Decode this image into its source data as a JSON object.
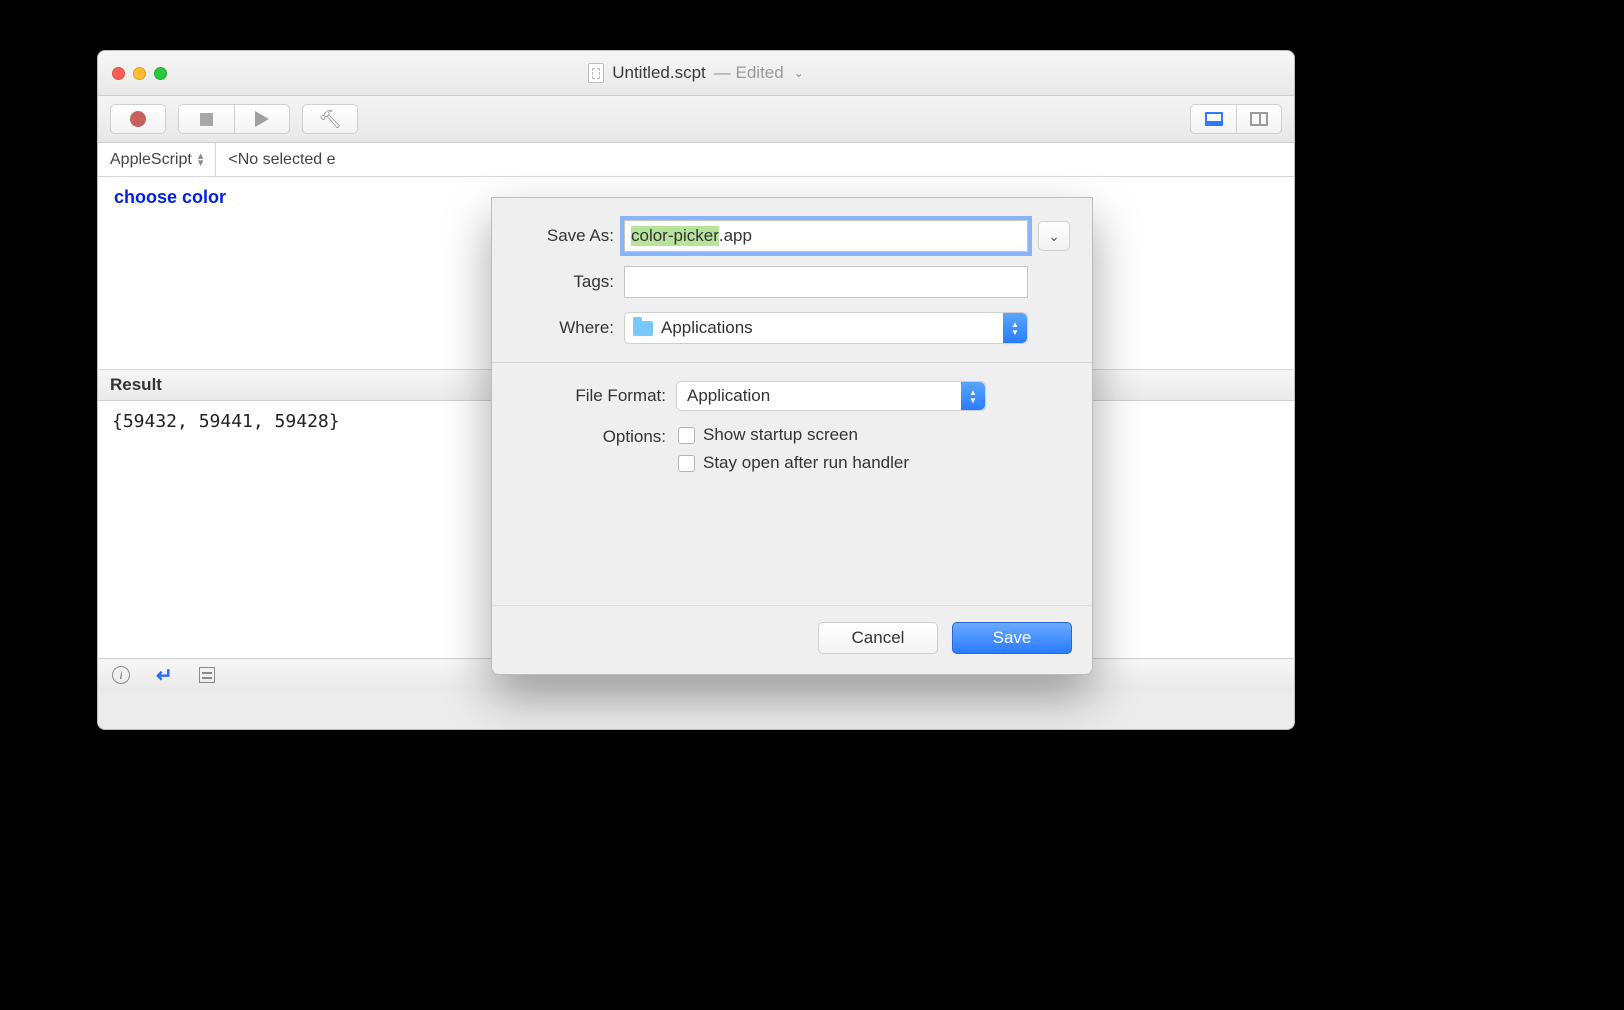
{
  "window": {
    "title": "Untitled.scpt",
    "status": "Edited"
  },
  "subbar": {
    "language": "AppleScript",
    "context": "<No selected e"
  },
  "code": "choose color",
  "result": {
    "header": "Result",
    "value": "{59432, 59441, 59428}"
  },
  "sheet": {
    "saveas_label": "Save As:",
    "filename_selected": "color-picker",
    "filename_ext": ".app",
    "tags_label": "Tags:",
    "where_label": "Where:",
    "where_value": "Applications",
    "file_format_label": "File Format:",
    "file_format_value": "Application",
    "options_label": "Options:",
    "opt_startup": "Show startup screen",
    "opt_stayopen": "Stay open after run handler",
    "cancel": "Cancel",
    "save": "Save"
  }
}
